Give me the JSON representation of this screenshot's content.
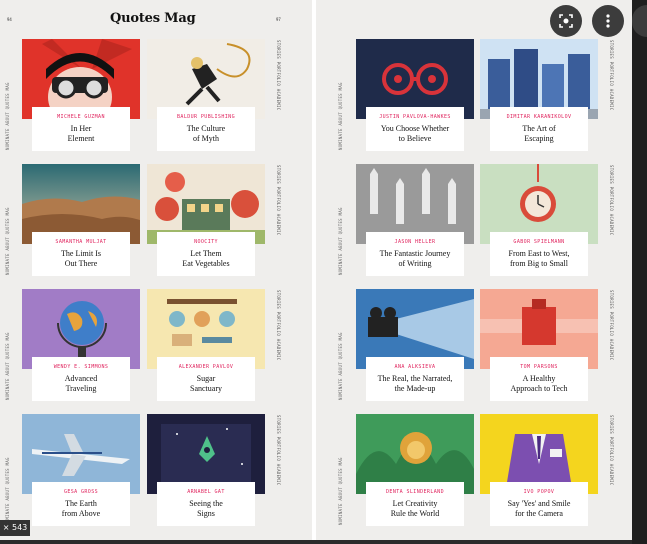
{
  "magazine": {
    "title": "Quotes Mag",
    "page_left": "94",
    "page_right": "97",
    "spine_left": "NOMINATE  ABOUT  QUOTES MAG",
    "spine_right": "STORIES  PORTFOLIO  ACADEMIC"
  },
  "left_cards": [
    {
      "author": "Michele Guzman",
      "title1": "In Her",
      "title2": "Element"
    },
    {
      "author": "Baldur Publishing",
      "title1": "The Culture",
      "title2": "of Myth"
    },
    {
      "author": "Samantha Muljat",
      "title1": "The Limit Is",
      "title2": "Out There"
    },
    {
      "author": "Noocity",
      "title1": "Let Them",
      "title2": "Eat Vegetables"
    },
    {
      "author": "Wendy E. Simmons",
      "title1": "Advanced",
      "title2": "Traveling"
    },
    {
      "author": "Alexander Pavlov",
      "title1": "Sugar",
      "title2": "Sanctuary"
    },
    {
      "author": "Gesa Gross",
      "title1": "The Earth",
      "title2": "from Above"
    },
    {
      "author": "Arnabel Gat",
      "title1": "Seeing the",
      "title2": "Signs"
    }
  ],
  "right_cards": [
    {
      "author": "Justin Pavlova-Hawkes",
      "title1": "You Choose Whether",
      "title2": "to Believe"
    },
    {
      "author": "Dimitar Karanikolov",
      "title1": "The Art of",
      "title2": "Escaping"
    },
    {
      "author": "Jason Heller",
      "title1": "The Fantastic Journey",
      "title2": "of Writing"
    },
    {
      "author": "Gabor Spielmann",
      "title1": "From East to West,",
      "title2": "from Big to Small"
    },
    {
      "author": "Ana Alksieva",
      "title1": "The Real, the Narrated,",
      "title2": "the Made-up"
    },
    {
      "author": "Tom Parsons",
      "title1": "A Healthy",
      "title2": "Approach to Tech"
    },
    {
      "author": "Denta Slinderland",
      "title1": "Let Creativity",
      "title2": "Rule the World"
    },
    {
      "author": "Ivo Popov",
      "title1": "Say 'Yes' and Smile",
      "title2": "for the Camera"
    }
  ],
  "controls": {
    "lens_icon": "lens-icon",
    "more_icon": "more-vert-icon",
    "zoom_label": "× 543"
  }
}
